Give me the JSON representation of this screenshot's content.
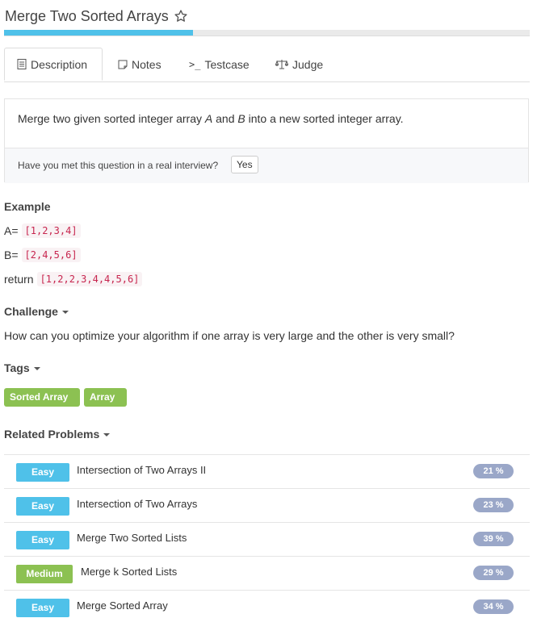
{
  "header": {
    "title": "Merge Two Sorted Arrays",
    "progress_percent": 36
  },
  "tabs": [
    {
      "label": "Description",
      "icon": "document-icon",
      "active": true
    },
    {
      "label": "Notes",
      "icon": "note-icon"
    },
    {
      "label": "Testcase",
      "icon": "terminal-icon"
    },
    {
      "label": "Judge",
      "icon": "balance-scale-icon"
    }
  ],
  "description": {
    "text_before": "Merge two given sorted integer array ",
    "var_a": "A",
    "text_middle": " and ",
    "var_b": "B",
    "text_after": " into a new sorted integer array.",
    "interview_question": "Have you met this question in a real interview?",
    "yes_label": "Yes"
  },
  "example": {
    "heading": "Example",
    "a_label": "A=",
    "a_value": "[1,2,3,4]",
    "b_label": "B=",
    "b_value": "[2,4,5,6]",
    "return_label": "return",
    "return_value": "[1,2,2,3,4,4,5,6]"
  },
  "challenge": {
    "heading": "Challenge",
    "text": "How can you optimize your algorithm if one array is very large and the other is very small?"
  },
  "tags": {
    "heading": "Tags",
    "items": [
      "Sorted Array",
      "Array"
    ]
  },
  "related": {
    "heading": "Related Problems",
    "items": [
      {
        "difficulty": "Easy",
        "name": "Intersection of Two Arrays II",
        "rate": "21 %"
      },
      {
        "difficulty": "Easy",
        "name": "Intersection of Two Arrays",
        "rate": "23 %"
      },
      {
        "difficulty": "Easy",
        "name": "Merge Two Sorted Lists",
        "rate": "39 %"
      },
      {
        "difficulty": "Medium",
        "name": "Merge k Sorted Lists",
        "rate": "29 %"
      },
      {
        "difficulty": "Easy",
        "name": "Merge Sorted Array",
        "rate": "34 %"
      }
    ]
  },
  "colors": {
    "accent": "#4fc1e9",
    "green": "#8cc152",
    "rate": "#9aa7c8",
    "code": "#c7254e"
  }
}
